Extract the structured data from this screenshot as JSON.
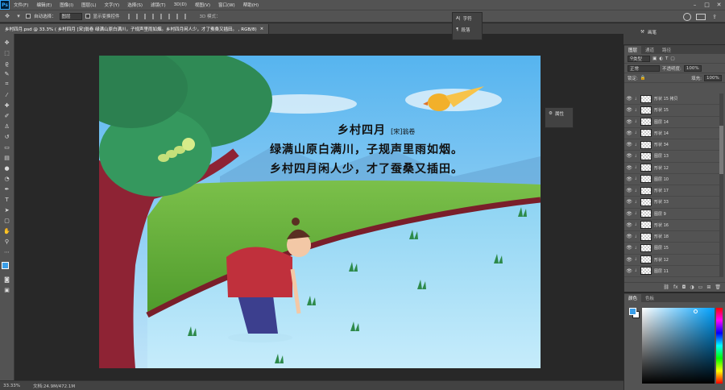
{
  "app": {
    "logo": "Ps"
  },
  "menubar": {
    "items": [
      "文件(F)",
      "编辑(E)",
      "图像(I)",
      "图层(L)",
      "文字(Y)",
      "选择(S)",
      "滤镜(T)",
      "3D(D)",
      "视图(V)",
      "窗口(W)",
      "帮助(H)"
    ]
  },
  "options": {
    "auto_select_label": "自动选择：",
    "auto_select_value": "图层",
    "transform_label": "显示变换控件",
    "mode_3d": "3D 模式："
  },
  "tabs": [
    {
      "label": "乡村四月.psd @ 33.3% ( 乡村四月 [宋]翁卷 绿满山原白满川，子规声里雨如烟。乡村四月闲人少，才了蚕桑又插田。 , RGB/8)",
      "close": "×"
    }
  ],
  "poem": {
    "title": "乡村四月",
    "author": "[宋]翁卷",
    "lines": [
      "绿满山原白满川，子规声里雨如烟。",
      "乡村四月闲人少，才了蚕桑又插田。"
    ]
  },
  "char_panel": {
    "char_label": "字符",
    "para_label": "段落"
  },
  "properties_panel": {
    "label": "属性"
  },
  "right_strip": {
    "brush_label": "画笔"
  },
  "layers": {
    "tabs": [
      "图层",
      "通道",
      "路径"
    ],
    "kind": "类型",
    "blend_mode": "正常",
    "opacity_label": "不透明度:",
    "opacity_value": "100%",
    "lock_label": "锁定:",
    "fill_label": "填充:",
    "fill_value": "100%",
    "items": [
      "形状 15 拷贝",
      "形状 15",
      "图层 14",
      "形状 14",
      "形状 34",
      "图层 13",
      "形状 12",
      "图层 10",
      "形状 17",
      "形状 33",
      "图层 9",
      "形状 16",
      "形状 18",
      "图层 15",
      "形状 12",
      "图层 11"
    ]
  },
  "color_panel": {
    "tabs": [
      "颜色",
      "色板"
    ],
    "fg": "#3a9ee8",
    "bg": "#ffffff"
  },
  "status": {
    "zoom": "33.33%",
    "doc": "文档:24.9M/472.1M"
  }
}
